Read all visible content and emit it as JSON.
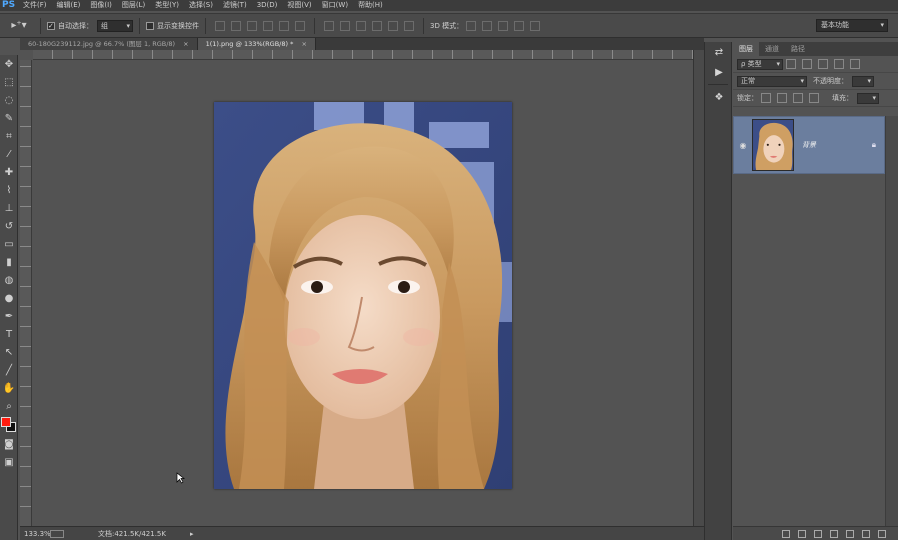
{
  "app": {
    "logo": "PS"
  },
  "menu": [
    "文件(F)",
    "编辑(E)",
    "图像(I)",
    "图层(L)",
    "类型(Y)",
    "选择(S)",
    "滤镜(T)",
    "3D(D)",
    "视图(V)",
    "窗口(W)",
    "帮助(H)"
  ],
  "options": {
    "auto_select_label": "自动选择：",
    "auto_select_value": "组",
    "show_transform_label": "显示变换控件",
    "mode_3d_label": "3D 模式：",
    "workspace": "基本功能"
  },
  "tabs": [
    {
      "label": "60-180G239112.jpg @ 66.7% (图层 1, RGB/8)",
      "active": false
    },
    {
      "label": "1(1).png @ 133%(RGB/8) *",
      "active": true
    }
  ],
  "status": {
    "zoom": "133.3%",
    "doc": "文档:421.5K/421.5K"
  },
  "panel": {
    "tabs": [
      "图层",
      "通道",
      "路径"
    ],
    "active_tab": 0,
    "filter_label": "ρ 类型",
    "blend_mode": "正常",
    "opacity_label": "不透明度：",
    "lock_label": "锁定：",
    "fill_label": "填充："
  },
  "layers": [
    {
      "name": "背景",
      "visible": true,
      "locked": true
    }
  ],
  "colors": {
    "foreground": "#ff1b0f",
    "background": "#111111",
    "selected_layer": "#6b7e9e"
  }
}
